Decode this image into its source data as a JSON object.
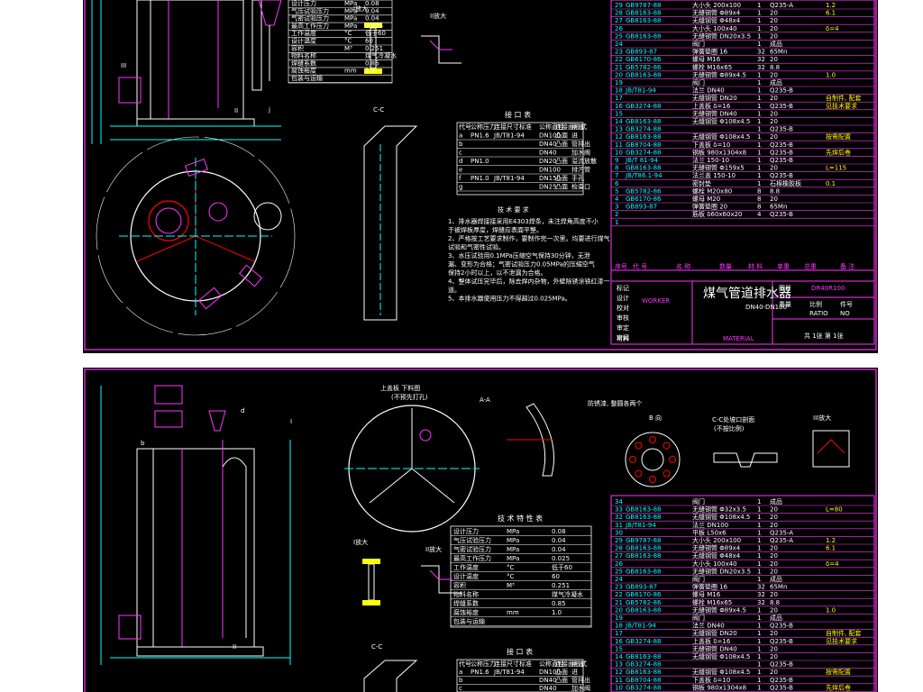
{
  "drawing": {
    "title_block": {
      "title": "煤气管道排水器",
      "code": "DN40-DN100",
      "drawing_no_label": "图号",
      "drawing_no": "DR40R100",
      "weight_label": "重量",
      "scale_label": "比例",
      "sheet_label": "件号",
      "scale_value": "RATIO",
      "sheet_value": "NO",
      "material_label": "材料",
      "material_value": "MATERIAL",
      "sheet_count": "共 1张 第 1张",
      "rows": [
        "标记",
        "设计",
        "校对",
        "审核",
        "审定",
        "审阅"
      ],
      "designer": "WORKER"
    },
    "views": {
      "detail_I": "I放大",
      "detail_II": "II放大",
      "detail_III": "III放大",
      "section_cc": "C-C",
      "section_aa": "A-A",
      "view_b": "B 向",
      "cover_plate": "上盖板 下料图",
      "cover_plate_note": "(不预先打孔)",
      "support_note": "防锈漆, 整圆各两个",
      "flange_note": "C-C处坡口剖面",
      "flange_note2": "(不按比例)"
    },
    "spec_table": {
      "title": "技 术 特 性 表",
      "rows": [
        {
          "name": "设计压力",
          "unit": "MPa",
          "value": "0.08"
        },
        {
          "name": "气压试验压力",
          "unit": "MPa",
          "value": "0.04"
        },
        {
          "name": "气密试验压力",
          "unit": "MPa",
          "value": "0.04"
        },
        {
          "name": "最高工作压力",
          "unit": "MPa",
          "value": "0.025"
        },
        {
          "name": "工作温度",
          "unit": "°C",
          "value": "低于60"
        },
        {
          "name": "设计温度",
          "unit": "°C",
          "value": "60"
        },
        {
          "name": "容积",
          "unit": "M³",
          "value": "0.251"
        },
        {
          "name": "物料名称",
          "unit": "",
          "value": "煤气冷凝水"
        },
        {
          "name": "焊缝系数",
          "unit": "",
          "value": "0.85"
        },
        {
          "name": "腐蚀裕度",
          "unit": "mm",
          "value": "1.0"
        },
        {
          "name": "包装与运输",
          "unit": "",
          "value": ""
        }
      ]
    },
    "nozzle_table": {
      "title": "接 口 表",
      "headers": [
        "代号",
        "公称压力",
        "连接尺寸标准",
        "公称直径",
        "连接面形式",
        "用途"
      ],
      "rows": [
        [
          "a",
          "PN1.6",
          "JB/T81-94",
          "DN100",
          "凸面",
          "进"
        ],
        [
          "b",
          "",
          "",
          "DN40",
          "凸面",
          "管排出"
        ],
        [
          "c",
          "",
          "",
          "DN40",
          "",
          "加水阀"
        ],
        [
          "d",
          "PN1.0",
          "",
          "DN20",
          "凸面",
          "溢流放散"
        ],
        [
          "e",
          "",
          "",
          "DN100",
          "",
          "排污管"
        ],
        [
          "f",
          "PN1.0",
          "JB/T81-94",
          "DN150",
          "凸面",
          "手孔"
        ],
        [
          "g",
          "",
          "",
          "DN25",
          "凸面",
          "检查口"
        ]
      ]
    },
    "tech_req": {
      "title": "技 术 要 求",
      "items": [
        "1、排水器焊接接采用E4303焊条，未注焊角高度不小于被焊板厚度，焊缝应表面平整。",
        "2、严格按工艺要求制作，要制作完一次里。均要进行煤气试验和气密性试验。",
        "3、水压试验用0.1MPa压缩空气保持30分钟，无泄漏、变形为合格；气密试验压力0.05MPa的压缩空气保持2小时以上，以不泄漏为合格。",
        "4、整体试压完毕后，除去焊内杂物，外壁除锈涂铁红漆一道。",
        "5、本排水器使用压力不得超过0.025MPa。"
      ]
    },
    "bom": {
      "footer": [
        "序号",
        "代 号",
        "名 称",
        "数量",
        "材 料",
        "单重",
        "总重",
        "备 注"
      ],
      "rows": [
        {
          "no": "34",
          "code": "",
          "name": "阀门",
          "qty": "1",
          "mat": "成品",
          "note": ""
        },
        {
          "no": "33",
          "code": "GB8163-88",
          "name": "无缝钢管 Φ32x3.5",
          "qty": "1",
          "mat": "20",
          "note": "L=80"
        },
        {
          "no": "32",
          "code": "GB8163-88",
          "name": "无缝钢管 Φ108x4.5",
          "qty": "1",
          "mat": "20",
          "note": ""
        },
        {
          "no": "31",
          "code": "JB/T81-94",
          "name": "法兰 DN100",
          "qty": "1",
          "mat": "20",
          "note": ""
        },
        {
          "no": "30",
          "code": "",
          "name": "平板 L50x6",
          "qty": "1",
          "mat": "Q235-A",
          "note": ""
        },
        {
          "no": "29",
          "code": "GB9787-88",
          "name": "大小头 200x100",
          "qty": "1",
          "mat": "Q235-A",
          "note": "1.2"
        },
        {
          "no": "28",
          "code": "GB8163-88",
          "name": "无缝钢管 Φ89x4",
          "qty": "1",
          "mat": "20",
          "note": "6.1"
        },
        {
          "no": "27",
          "code": "GB8163-88",
          "name": "无缝钢管 Φ48x4",
          "qty": "1",
          "mat": "20",
          "note": ""
        },
        {
          "no": "26",
          "code": "",
          "name": "大小头 100x40",
          "qty": "1",
          "mat": "20",
          "note": "δ=4"
        },
        {
          "no": "25",
          "code": "GB8163-88",
          "name": "无缝钢管 DN20x3.5",
          "qty": "1",
          "mat": "20",
          "note": ""
        },
        {
          "no": "24",
          "code": "",
          "name": "阀门",
          "qty": "1",
          "mat": "成品",
          "note": ""
        },
        {
          "no": "23",
          "code": "GB893-87",
          "name": "弹簧垫圈 16",
          "qty": "32",
          "mat": "65Mn",
          "note": ""
        },
        {
          "no": "22",
          "code": "GB6170-86",
          "name": "螺母 M16",
          "qty": "32",
          "mat": "20",
          "note": ""
        },
        {
          "no": "21",
          "code": "GB5782-86",
          "name": "螺栓 M16x65",
          "qty": "32",
          "mat": "8.8",
          "note": ""
        },
        {
          "no": "20",
          "code": "GB8163-88",
          "name": "无缝钢管 Φ89x4.5",
          "qty": "1",
          "mat": "20",
          "note": "1.0"
        },
        {
          "no": "19",
          "code": "",
          "name": "阀门",
          "qty": "1",
          "mat": "成品",
          "note": ""
        },
        {
          "no": "18",
          "code": "JB/T81-94",
          "name": "法兰 DN40",
          "qty": "1",
          "mat": "Q235-B",
          "note": ""
        },
        {
          "no": "17",
          "code": "",
          "name": "无缝钢管 DN20",
          "qty": "1",
          "mat": "20",
          "note": "自制件, 配套"
        },
        {
          "no": "16",
          "code": "GB3274-88",
          "name": "上盖板 δ=16",
          "qty": "1",
          "mat": "Q235-B",
          "note": "见技术要求"
        },
        {
          "no": "15",
          "code": "",
          "name": "无缝钢管 DN40",
          "qty": "1",
          "mat": "20",
          "note": ""
        },
        {
          "no": "14",
          "code": "GB8163-88",
          "name": "无缝钢管 Φ108x4.5",
          "qty": "1",
          "mat": "20",
          "note": ""
        },
        {
          "no": "13",
          "code": "GB3274-88",
          "name": "",
          "qty": "1",
          "mat": "Q235-B",
          "note": ""
        },
        {
          "no": "12",
          "code": "GB8163-88",
          "name": "无缝钢管 Φ108x4.5",
          "qty": "1",
          "mat": "20",
          "note": "按需配置"
        },
        {
          "no": "11",
          "code": "GB8704-88",
          "name": "下盖板 δ=10",
          "qty": "1",
          "mat": "Q235-B",
          "note": ""
        },
        {
          "no": "10",
          "code": "GB3274-88",
          "name": "钢板 980x1304x8",
          "qty": "1",
          "mat": "Q235-B",
          "note": "先焊后卷"
        },
        {
          "no": "9",
          "code": "JB/T 81-94",
          "name": "法兰 150-10",
          "qty": "1",
          "mat": "Q235-B",
          "note": ""
        },
        {
          "no": "8",
          "code": "GB8163-88",
          "name": "无缝钢管 Φ159x5",
          "qty": "1",
          "mat": "20",
          "note": "L=115"
        },
        {
          "no": "7",
          "code": "JB/T86.1-94",
          "name": "法兰盖 150-10",
          "qty": "1",
          "mat": "Q235-B",
          "note": ""
        },
        {
          "no": "6",
          "code": "",
          "name": "密封垫",
          "qty": "1",
          "mat": "石棉橡胶板",
          "note": "0.1"
        },
        {
          "no": "5",
          "code": "GB5782-86",
          "name": "螺栓 M20x80",
          "qty": "8",
          "mat": "8.8",
          "note": ""
        },
        {
          "no": "4",
          "code": "GB6170-86",
          "name": "螺母 M20",
          "qty": "8",
          "mat": "20",
          "note": ""
        },
        {
          "no": "3",
          "code": "GB893-87",
          "name": "弹簧垫圈 20",
          "qty": "8",
          "mat": "65Mn",
          "note": ""
        },
        {
          "no": "2",
          "code": "",
          "name": "筋板 δ60x60x20",
          "qty": "4",
          "mat": "Q235-B",
          "note": ""
        },
        {
          "no": "1",
          "code": "",
          "name": "",
          "qty": "",
          "mat": "",
          "note": ""
        }
      ]
    },
    "markers": {
      "I": "I",
      "II": "II",
      "III": "III",
      "a": "a",
      "b": "b",
      "c": "c",
      "d": "d",
      "e": "e",
      "f": "f",
      "g": "g",
      "j": "j"
    },
    "colors": {
      "background": "#000000",
      "outline": "#ff33ff",
      "geometry": "#ffffff",
      "dimension": "#00ffff",
      "accent": "#ffff00",
      "hatch": "#ff0000"
    }
  }
}
